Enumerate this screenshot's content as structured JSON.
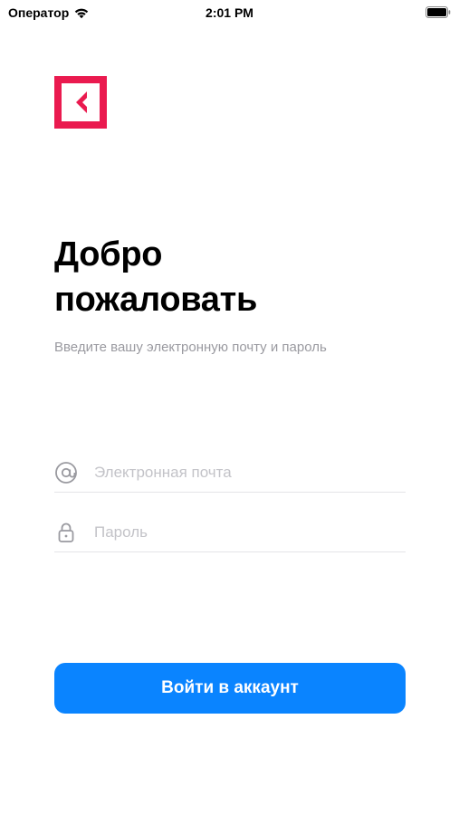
{
  "status_bar": {
    "carrier": "Оператор",
    "time": "2:01 PM",
    "icons": [
      "wifi-icon",
      "battery-icon"
    ]
  },
  "logo": {
    "icon": "back-chevron-logo",
    "color": "#ea1a4f"
  },
  "welcome": {
    "title_line1": "Добро",
    "title_line2": "пожаловать",
    "subtitle": "Введите вашу электронную почту и пароль"
  },
  "form": {
    "email": {
      "placeholder": "Электронная почта",
      "value": "",
      "icon": "at-icon"
    },
    "password": {
      "placeholder": "Пароль",
      "value": "",
      "icon": "lock-icon"
    },
    "submit_label": "Войти в аккаунт"
  },
  "colors": {
    "accent": "#0a84ff",
    "brand": "#ea1a4f",
    "muted_text": "#9a9aa0"
  }
}
